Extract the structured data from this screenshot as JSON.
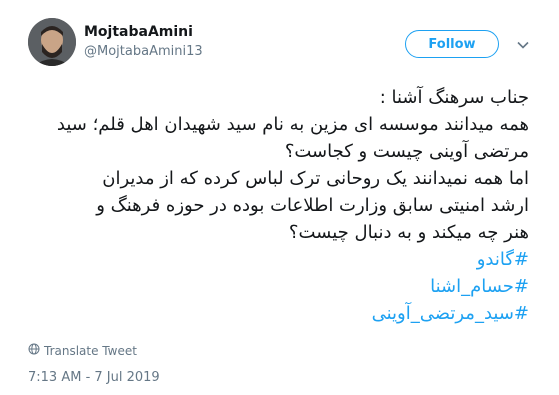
{
  "user": {
    "display_name": "MojtabaAmini",
    "handle": "@MojtabaAmini13"
  },
  "follow_label": "Follow",
  "tweet": {
    "lines": [
      "جناب سرهنگ آشنا :",
      "همه میدانند موسسه ای مزین به نام سید شهیدان اهل قلم؛ سید",
      "مرتضی آوینی چیست و کجاست؟",
      "اما همه نمیدانند یک روحانی ترک لباس کرده که از مدیران",
      "ارشد امنیتی سابق وزارت اطلاعات بوده در حوزه فرهنگ و",
      "هنر چه میکند و به دنبال چیست؟"
    ],
    "hashtags": [
      "#گاندو",
      "#حسام_اشنا",
      "#سید_مرتضی_آوینی"
    ]
  },
  "translate_label": "Translate Tweet",
  "timestamp": "7:13 AM - 7 Jul 2019",
  "colors": {
    "accent": "#1da1f2",
    "muted": "#657786",
    "text": "#14171a"
  }
}
